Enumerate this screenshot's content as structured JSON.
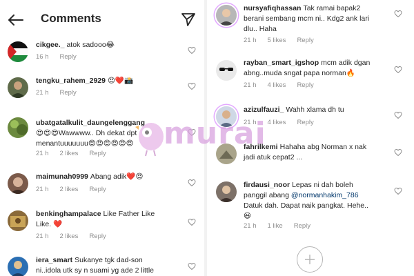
{
  "header": {
    "title": "Comments"
  },
  "left_comments": [
    {
      "username": "cikgee._",
      "text": "atok sadooo😂",
      "lines": [],
      "time": "16 h",
      "likes": "",
      "reply": "Reply"
    },
    {
      "username": "tengku_rahem_2929",
      "text": "😍❤️📸",
      "lines": [],
      "time": "21 h",
      "likes": "",
      "reply": "Reply"
    },
    {
      "username": "ubatgatalkulit_daungelenggang",
      "text": "",
      "lines": [
        "😍😍😍Wawwww.. Dh dekat dpt",
        "menantuuuuuuu😍😍😍😍😍😍"
      ],
      "time": "21 h",
      "likes": "2 likes",
      "reply": "Reply"
    },
    {
      "username": "maimunah0999",
      "text": "Abang adik❤️😍",
      "lines": [],
      "time": "21 h",
      "likes": "2 likes",
      "reply": "Reply"
    },
    {
      "username": "benkinghampalace",
      "text": "Like Father Like",
      "lines": [
        "Like. ❤️"
      ],
      "time": "21 h",
      "likes": "2 likes",
      "reply": "Reply"
    },
    {
      "username": "iera_smart",
      "text": "Sukanye tgk dad-son",
      "lines": [
        "ni..idola utk sy n suami yg ade 2 little"
      ],
      "time": "",
      "likes": "",
      "reply": ""
    }
  ],
  "right_comments": [
    {
      "username": "nursyafiqhassan",
      "text": "Tak ramai bapak2",
      "lines": [
        "berani sembang mcm ni.. Kdg2 ank lari",
        "dlu.. Haha"
      ],
      "time": "21 h",
      "likes": "5 likes",
      "reply": "Reply"
    },
    {
      "username": "rayban_smart_igshop",
      "text": "mcm adik dgan",
      "lines": [
        "abng..muda sngat papa norman🔥"
      ],
      "time": "21 h",
      "likes": "4 likes",
      "reply": "Reply"
    },
    {
      "username": "azizulfauzi_",
      "text": "Wahh xlama dh tu",
      "lines": [],
      "time": "21 h",
      "likes": "4 likes",
      "reply": "Reply"
    },
    {
      "username": "fahrilkemi",
      "text": "Hahaha abg Norman x nak",
      "lines": [
        "jadi atuk cepat2 ..."
      ],
      "time": "",
      "likes": "",
      "reply": ""
    },
    {
      "username": "firdausi_noor",
      "text": "Lepas ni dah boleh",
      "mention": "@normanhakim_786",
      "prefix2": "panggil abang ",
      "lines": [
        "Datuk dah. Dapat naik pangkat. Hehe..",
        "😆"
      ],
      "time": "21 h",
      "likes": "1 like",
      "reply": "Reply"
    }
  ],
  "watermark": {
    "text": "murai"
  },
  "icons": {
    "back": "arrow-left-icon",
    "share": "paper-plane-icon",
    "like": "heart-outline-icon",
    "add": "plus-icon"
  },
  "colors": {
    "text": "#262626",
    "meta": "#8e8e8e",
    "mention": "#00376b",
    "watermark": "#d9a3df"
  }
}
